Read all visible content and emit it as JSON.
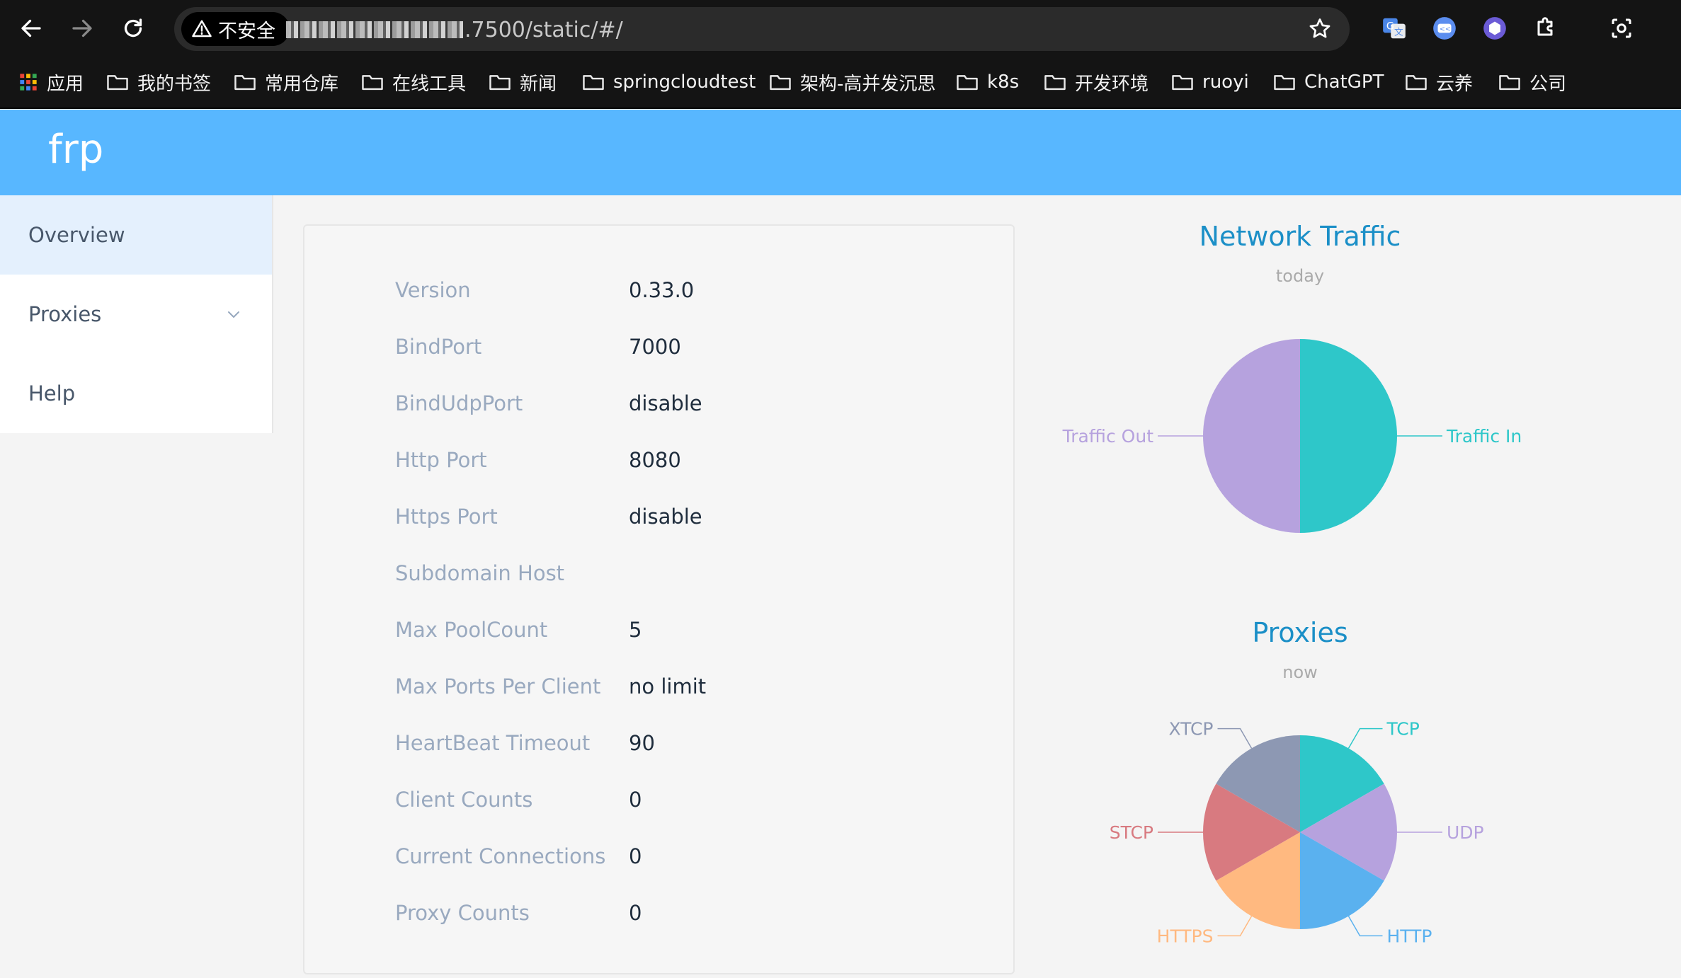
{
  "browser": {
    "security_label": "不安全",
    "url_suffix": ".7500/static/#/"
  },
  "bookmarks": [
    {
      "label": "应用"
    },
    {
      "label": "我的书签"
    },
    {
      "label": "常用仓库"
    },
    {
      "label": "在线工具"
    },
    {
      "label": "新闻"
    },
    {
      "label": "springcloudtest"
    },
    {
      "label": "架构-高并发沉思"
    },
    {
      "label": "k8s"
    },
    {
      "label": "开发环境"
    },
    {
      "label": "ruoyi"
    },
    {
      "label": "ChatGPT"
    },
    {
      "label": "云养"
    },
    {
      "label": "公司"
    }
  ],
  "app": {
    "brand": "frp"
  },
  "sidebar": {
    "items": [
      {
        "label": "Overview"
      },
      {
        "label": "Proxies"
      },
      {
        "label": "Help"
      }
    ]
  },
  "overview": {
    "rows": [
      {
        "label": "Version",
        "value": "0.33.0"
      },
      {
        "label": "BindPort",
        "value": "7000"
      },
      {
        "label": "BindUdpPort",
        "value": "disable"
      },
      {
        "label": "Http Port",
        "value": "8080"
      },
      {
        "label": "Https Port",
        "value": "disable"
      },
      {
        "label": "Subdomain Host",
        "value": ""
      },
      {
        "label": "Max PoolCount",
        "value": "5"
      },
      {
        "label": "Max Ports Per Client",
        "value": "no limit"
      },
      {
        "label": "HeartBeat Timeout",
        "value": "90"
      },
      {
        "label": "Client Counts",
        "value": "0"
      },
      {
        "label": "Current Connections",
        "value": "0"
      },
      {
        "label": "Proxy Counts",
        "value": "0"
      }
    ]
  },
  "colors": {
    "header": "#58b7ff",
    "chart_title": "#1b8fc7"
  },
  "chart_data": [
    {
      "type": "pie",
      "title": "Network Traffic",
      "subtitle": "today",
      "categories": [
        "Traffic In",
        "Traffic Out"
      ],
      "values": [
        1,
        1
      ],
      "colors": [
        "#2ec7c9",
        "#b6a2de"
      ]
    },
    {
      "type": "pie",
      "title": "Proxies",
      "subtitle": "now",
      "categories": [
        "TCP",
        "UDP",
        "HTTP",
        "HTTPS",
        "STCP",
        "XTCP"
      ],
      "values": [
        1,
        1,
        1,
        1,
        1,
        1
      ],
      "colors": [
        "#2ec7c9",
        "#b6a2de",
        "#5ab1ef",
        "#ffb980",
        "#d87a80",
        "#8d98b3"
      ]
    }
  ]
}
